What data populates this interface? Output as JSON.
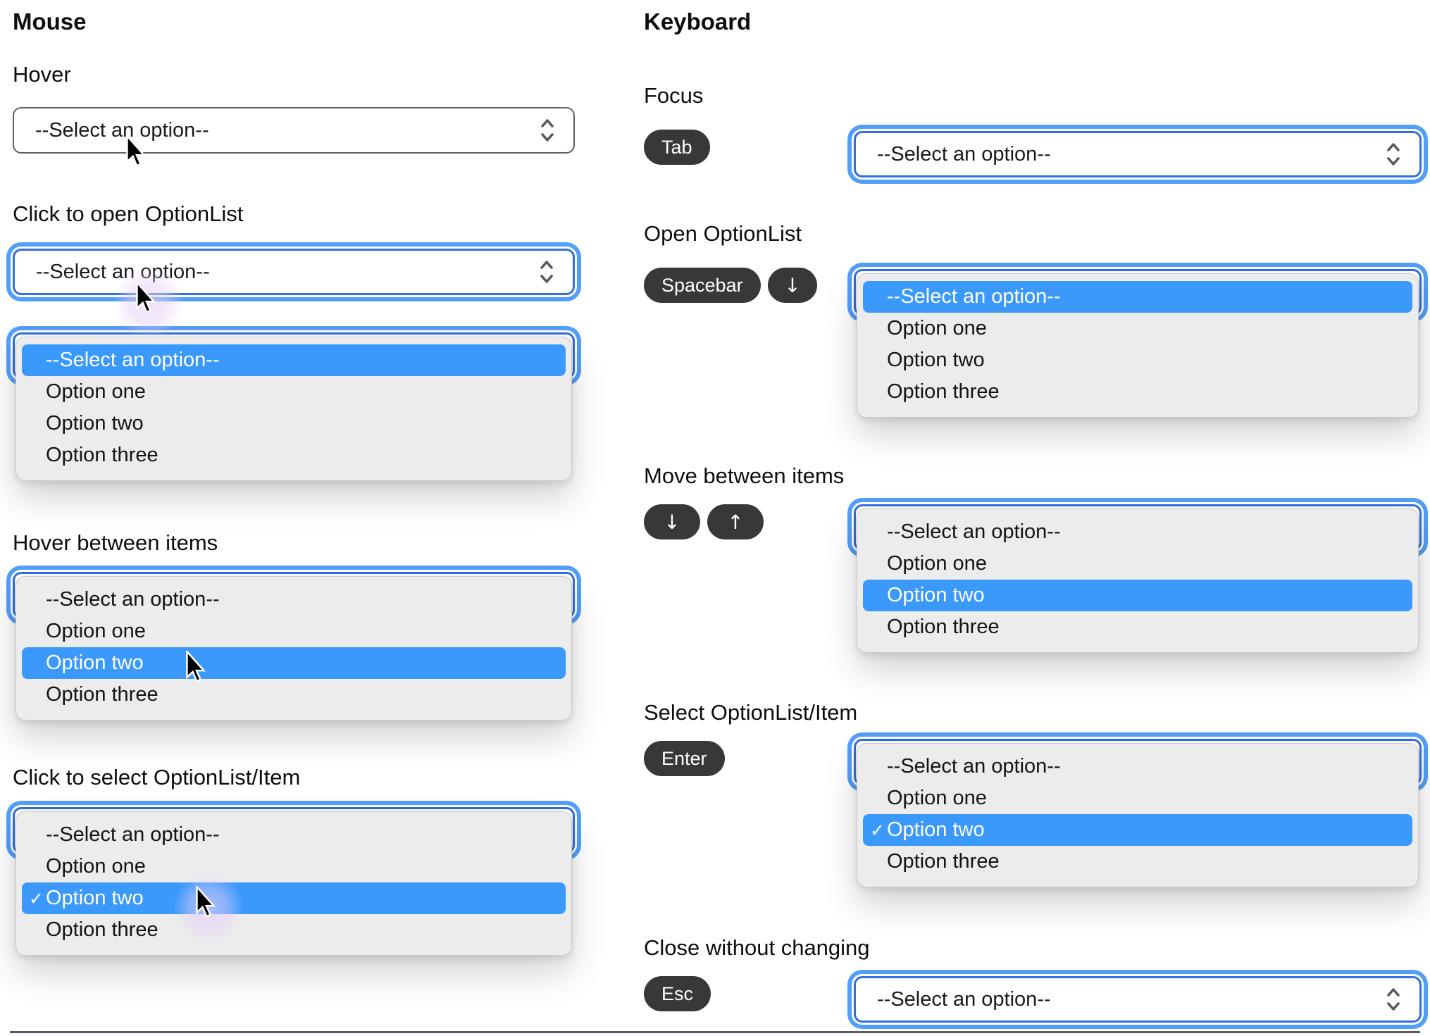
{
  "colors": {
    "highlight_blue": "#3b99fc",
    "focus_ring_outer": "#539ef7",
    "focus_ring_inner": "#2f6ee3",
    "panel_bg": "#ececec",
    "key_pill_bg": "#38383b",
    "select_border_gray": "#5f6066"
  },
  "shared": {
    "select_value": "--Select an option--",
    "options": [
      "--Select an option--",
      "Option one",
      "Option two",
      "Option three"
    ],
    "check_glyph": "✓"
  },
  "mouse": {
    "title": "Mouse",
    "sections": {
      "hover": {
        "label": "Hover"
      },
      "click_open": {
        "label": "Click to open OptionList"
      },
      "hover_items": {
        "label": "Hover between items"
      },
      "click_select": {
        "label": "Click to select OptionList/Item"
      }
    }
  },
  "keyboard": {
    "title": "Keyboard",
    "sections": {
      "focus": {
        "label": "Focus",
        "keys": [
          "Tab"
        ]
      },
      "open": {
        "label": "Open OptionList",
        "keys": [
          "Spacebar",
          "↓"
        ]
      },
      "move": {
        "label": "Move between items",
        "keys": [
          "↓",
          "↑"
        ]
      },
      "select": {
        "label": "Select OptionList/Item",
        "keys": [
          "Enter"
        ]
      },
      "close": {
        "label": "Close without changing",
        "keys": [
          "Esc"
        ]
      }
    }
  }
}
